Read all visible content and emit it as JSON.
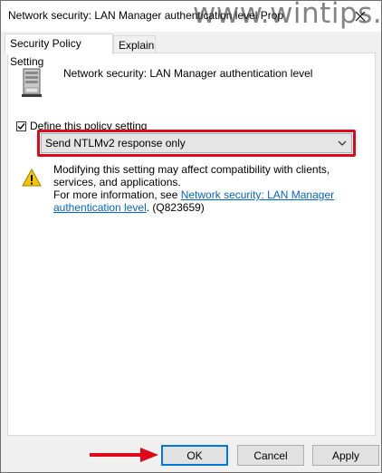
{
  "window": {
    "title": "Network security: LAN Manager authentication level Prop",
    "watermark": "www.wintips.org"
  },
  "tabs": [
    {
      "label": "Security Policy Setting",
      "active": true
    },
    {
      "label": "Explain",
      "active": false
    }
  ],
  "policy": {
    "name": "Network security: LAN Manager authentication level",
    "icon": "server-icon"
  },
  "define": {
    "label": "Define this policy setting",
    "checked": true
  },
  "dropdown": {
    "selected": "Send NTLMv2 response only",
    "highlight_color": "#e2061b"
  },
  "warning": {
    "icon": "warning-icon",
    "line1": "Modifying this setting may affect compatibility with clients, services, and applications.",
    "more_prefix": "For more information, see ",
    "link_text": "Network security: LAN Manager authentication level",
    "suffix": ". (Q823659)"
  },
  "buttons": {
    "ok": "OK",
    "cancel": "Cancel",
    "apply": "Apply",
    "accent": "#0078d7"
  },
  "annotation": {
    "arrow_color": "#e2061b"
  }
}
